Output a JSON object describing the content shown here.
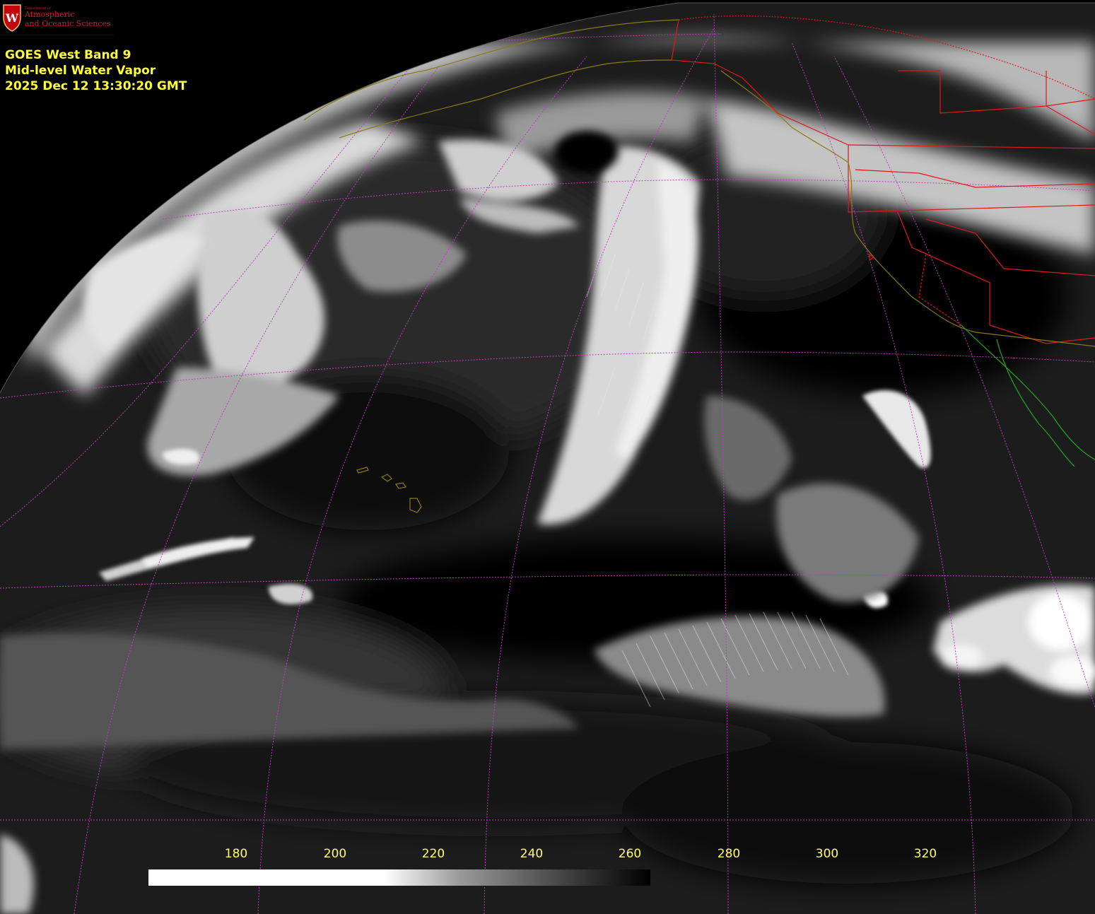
{
  "logo": {
    "department": "Department of",
    "line1": "Atmospheric",
    "line2": "and Oceanic Sciences",
    "crest_letter": "W"
  },
  "header": {
    "line1": "GOES West Band 9",
    "line2": "Mid-level Water Vapor",
    "line3": "2025 Dec 12  13:30:20 GMT"
  },
  "colorbar": {
    "ticks": [
      "180",
      "200",
      "220",
      "240",
      "260",
      "280",
      "300",
      "320"
    ]
  },
  "colors": {
    "header_text": "#ffff33",
    "tick_text": "#ffff66",
    "gridlines": "#c03cc0",
    "political_borders": "#e01818",
    "coastlines": "#8a7a10",
    "mexico_coast": "#1faa1f",
    "logo_red": "#c9202f"
  }
}
